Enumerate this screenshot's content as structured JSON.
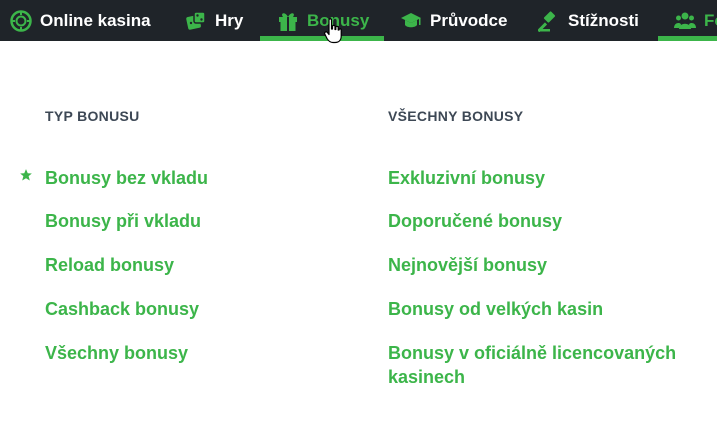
{
  "nav": {
    "items": [
      {
        "label": "Online kasina",
        "icon": "poker-chip-icon"
      },
      {
        "label": "Hry",
        "icon": "dice-icon"
      },
      {
        "label": "Bonusy",
        "icon": "gift-icon"
      },
      {
        "label": "Průvodce",
        "icon": "graduation-cap-icon"
      },
      {
        "label": "Stížnosti",
        "icon": "gavel-icon"
      },
      {
        "label": "Fo",
        "icon": "users-icon"
      }
    ],
    "active_index": 2
  },
  "dropdown": {
    "col1": {
      "heading": "TYP BONUSU",
      "links": [
        "Bonusy bez vkladu",
        "Bonusy při vkladu",
        "Reload bonusy",
        "Cashback bonusy",
        "Všechny bonusy"
      ]
    },
    "col2": {
      "heading": "VŠECHNY BONUSY",
      "links": [
        "Exkluzivní bonusy",
        "Doporučené bonusy",
        "Nejnovější bonusy",
        "Bonusy od velkých kasin",
        "Bonusy v oficiálně licencovaných",
        "kasinech"
      ]
    }
  },
  "colors": {
    "accent": "#3cb54a",
    "nav_bg": "#1f2429",
    "heading": "#3d4855"
  }
}
